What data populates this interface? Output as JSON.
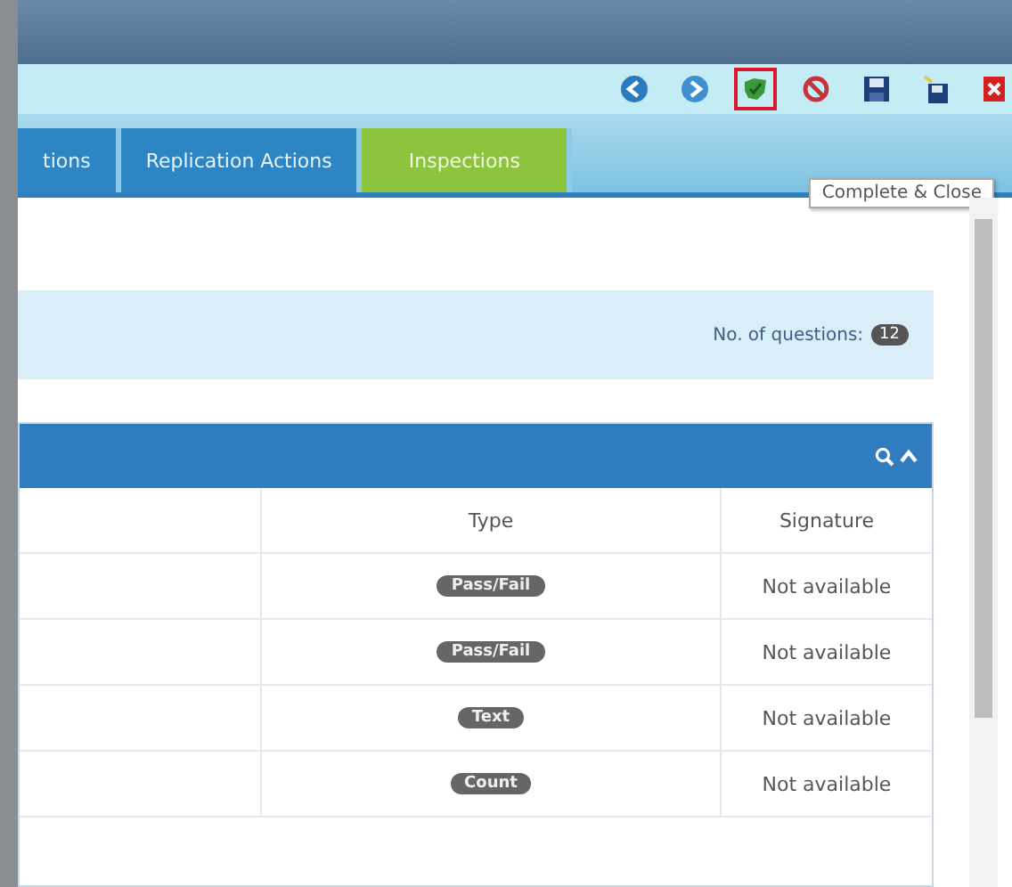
{
  "toolbar": {
    "buttons": [
      {
        "kind": "back",
        "highlighted": false
      },
      {
        "kind": "forward",
        "highlighted": false
      },
      {
        "kind": "complete",
        "highlighted": true
      },
      {
        "kind": "cancel",
        "highlighted": false
      },
      {
        "kind": "save",
        "highlighted": false
      },
      {
        "kind": "save-close",
        "highlighted": false
      },
      {
        "kind": "close",
        "highlighted": false
      }
    ],
    "tooltip": "Complete & Close"
  },
  "tabs": [
    {
      "label": "tions",
      "selected": false
    },
    {
      "label": "Replication Actions",
      "selected": false
    },
    {
      "label": "Inspections",
      "selected": true
    }
  ],
  "info_panel": {
    "label": "No. of questions:",
    "count": "12"
  },
  "table": {
    "columns": [
      "Type",
      "Signature"
    ],
    "rows": [
      {
        "type": "Pass/Fail",
        "signature": "Not available"
      },
      {
        "type": "Pass/Fail",
        "signature": "Not available"
      },
      {
        "type": "Text",
        "signature": "Not available"
      },
      {
        "type": "Count",
        "signature": "Not available"
      }
    ]
  }
}
